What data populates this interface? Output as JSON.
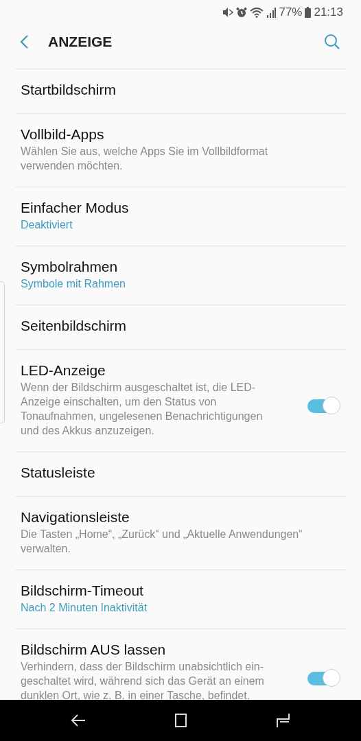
{
  "status_bar": {
    "battery": "77%",
    "time": "21:13"
  },
  "header": {
    "title": "ANZEIGE"
  },
  "items": [
    {
      "kind": "plain",
      "title": "Startbildschirm"
    },
    {
      "kind": "description",
      "title": "Vollbild-Apps",
      "text": "Wählen Sie aus, welche Apps Sie im Vollbildformat verwenden möchten."
    },
    {
      "kind": "value",
      "title": "Einfacher Modus",
      "text": "Deaktiviert"
    },
    {
      "kind": "value",
      "title": "Symbolrahmen",
      "text": "Symbole mit Rahmen"
    },
    {
      "kind": "plain",
      "title": "Seitenbildschirm"
    },
    {
      "kind": "switch",
      "title": "LED-Anzeige",
      "text": "Wenn der Bildschirm ausgeschaltet ist, die LED-Anzeige einschalten, um den Status von Tonaufnahmen, ungelesenen Benachrichtigungen und des Akkus anzuzeigen.",
      "on": true
    },
    {
      "kind": "plain",
      "title": "Statusleiste"
    },
    {
      "kind": "description",
      "title": "Navigationsleiste",
      "text": "Die Tasten „Home“, „Zurück“ und „Aktuelle Anwendungen“ verwalten."
    },
    {
      "kind": "value",
      "title": "Bildschirm-Timeout",
      "text": "Nach 2 Minuten Inaktivität"
    },
    {
      "kind": "switch",
      "title": "Bildschirm AUS lassen",
      "text": "Verhindern, dass der Bildschirm unabsichtlich ein-geschaltet wird, während sich das Gerät an einem dunklen Ort, wie z. B. in einer Tasche, befindet.",
      "on": true
    }
  ]
}
